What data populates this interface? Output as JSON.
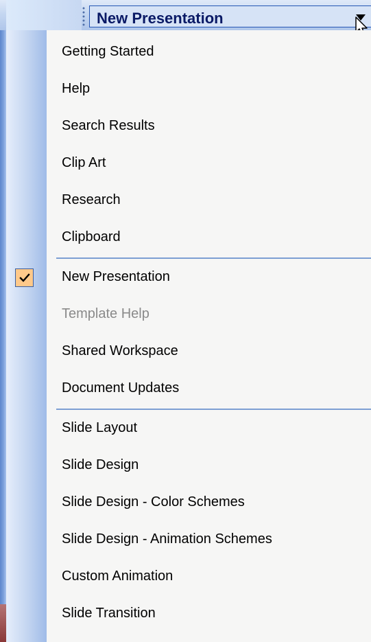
{
  "task_pane": {
    "current_pane": "New Presentation"
  },
  "menu": {
    "groups": [
      [
        {
          "label": "Getting Started",
          "checked": false,
          "disabled": false
        },
        {
          "label": "Help",
          "checked": false,
          "disabled": false
        },
        {
          "label": "Search Results",
          "checked": false,
          "disabled": false
        },
        {
          "label": "Clip Art",
          "checked": false,
          "disabled": false
        },
        {
          "label": "Research",
          "checked": false,
          "disabled": false
        },
        {
          "label": "Clipboard",
          "checked": false,
          "disabled": false
        }
      ],
      [
        {
          "label": "New Presentation",
          "checked": true,
          "disabled": false
        },
        {
          "label": "Template Help",
          "checked": false,
          "disabled": true
        },
        {
          "label": "Shared Workspace",
          "checked": false,
          "disabled": false
        },
        {
          "label": "Document Updates",
          "checked": false,
          "disabled": false
        }
      ],
      [
        {
          "label": "Slide Layout",
          "checked": false,
          "disabled": false
        },
        {
          "label": "Slide Design",
          "checked": false,
          "disabled": false
        },
        {
          "label": "Slide Design - Color Schemes",
          "checked": false,
          "disabled": false
        },
        {
          "label": "Slide Design - Animation Schemes",
          "checked": false,
          "disabled": false
        },
        {
          "label": "Custom Animation",
          "checked": false,
          "disabled": false
        },
        {
          "label": "Slide Transition",
          "checked": false,
          "disabled": false
        }
      ]
    ]
  },
  "icons": {
    "checked": "checkmark-icon",
    "dropdown": "dropdown-arrow-icon",
    "cursor": "mouse-pointer-icon"
  },
  "colors": {
    "title_text": "#0a1a66",
    "dropdown_border": "#2456b4",
    "separator": "#7d9fd3",
    "check_highlight": "#ffc98a",
    "disabled_text": "#8a8a8a"
  }
}
